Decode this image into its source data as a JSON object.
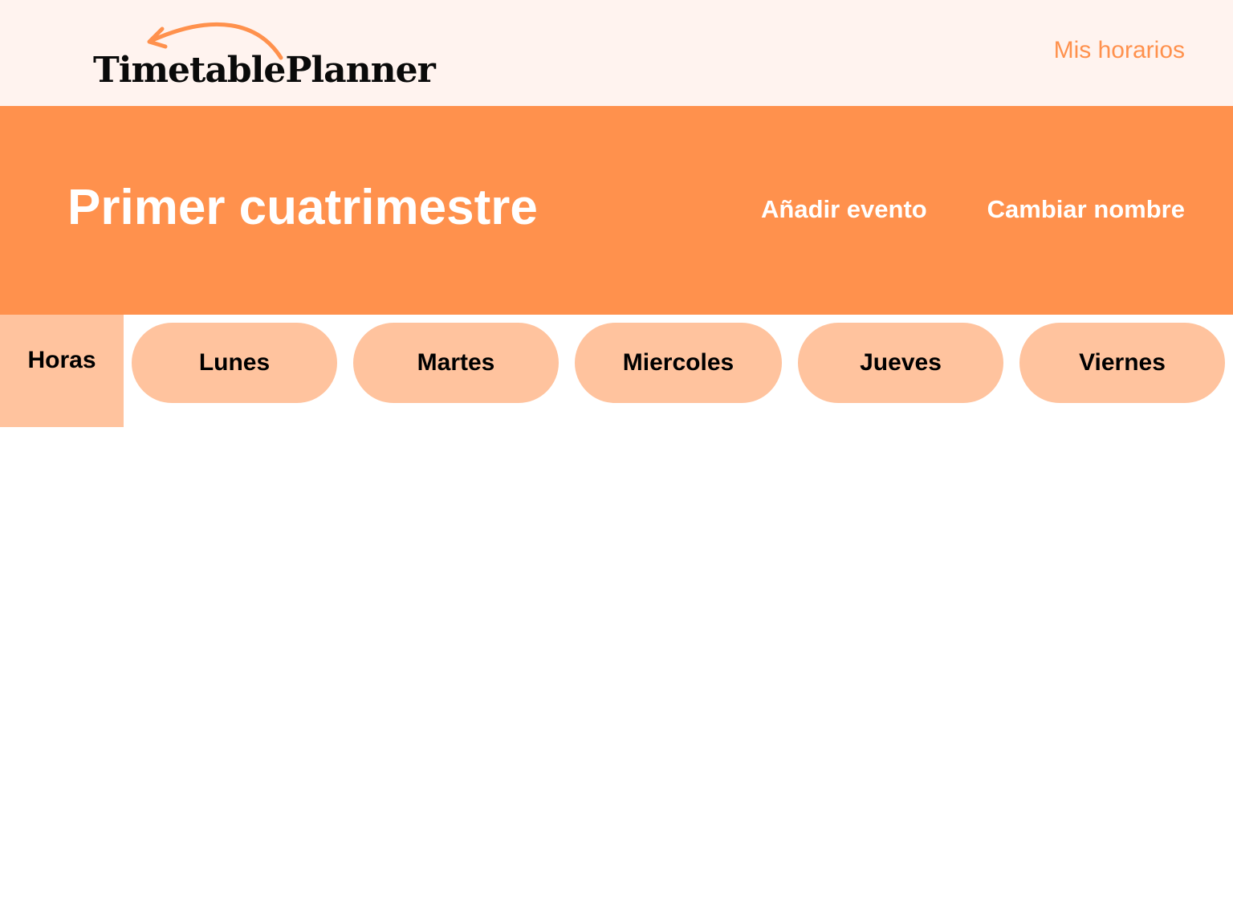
{
  "header": {
    "logo_text": "TimetablePlanner",
    "nav_link": "Mis horarios"
  },
  "hero": {
    "title": "Primer cuatrimestre",
    "add_event": "Añadir evento",
    "rename": "Cambiar nombre"
  },
  "schedule": {
    "hours_label": "Horas",
    "days": [
      "Lunes",
      "Martes",
      "Miercoles",
      "Jueves",
      "Viernes"
    ]
  },
  "colors": {
    "accent": "#ff914d",
    "light_accent": "#ffc39e",
    "header_bg": "#fff3ef"
  },
  "icons": {
    "logo_arrow": "curved-arrow-icon"
  }
}
